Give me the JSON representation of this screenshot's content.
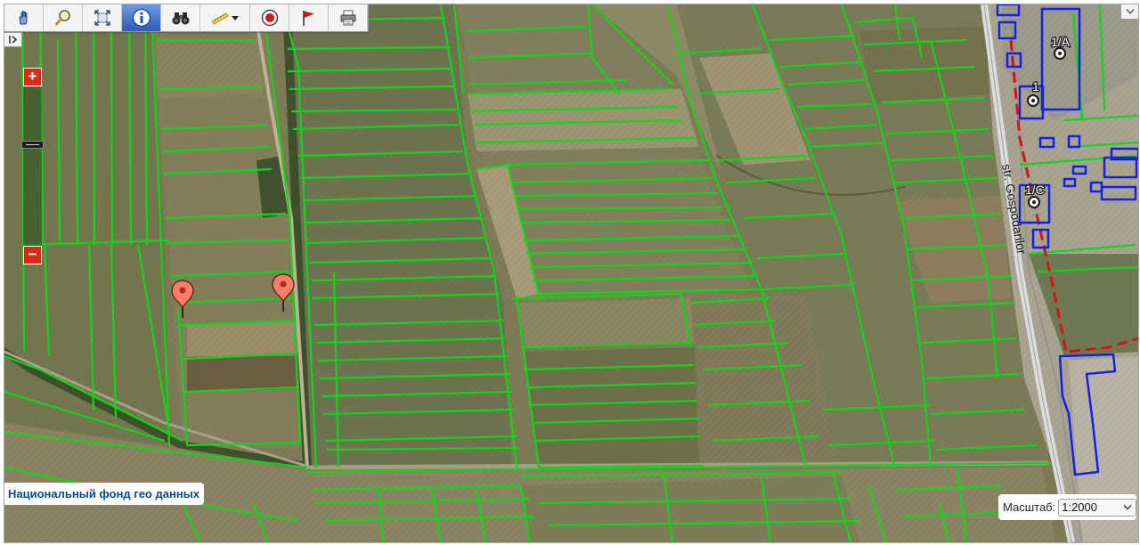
{
  "attribution": "Национальный фонд гео данных",
  "scale": {
    "label": "Масштаб:",
    "value": "1:2000"
  },
  "zoom": {
    "in": "+",
    "out": "−"
  },
  "street": "str. Gospodarilor",
  "addresses": [
    "1/A",
    "1",
    "1/C"
  ],
  "toolbar": {
    "tools": [
      {
        "name": "pan",
        "icon": "hand-icon"
      },
      {
        "name": "zoom-rectangle",
        "icon": "magnifier-icon"
      },
      {
        "name": "full-extent",
        "icon": "full-extent-icon"
      },
      {
        "name": "identify",
        "icon": "info-icon",
        "active": true
      },
      {
        "name": "search",
        "icon": "binoculars-icon"
      },
      {
        "name": "measure",
        "icon": "ruler-icon",
        "has_dropdown": true
      },
      {
        "name": "locate",
        "icon": "target-icon"
      },
      {
        "name": "mark",
        "icon": "flag-icon"
      },
      {
        "name": "print",
        "icon": "printer-icon"
      }
    ]
  },
  "markers": [
    {
      "name": "marker-1",
      "icon": "map-pin-icon",
      "color": "#ff7b6a"
    },
    {
      "name": "marker-2",
      "icon": "map-pin-icon",
      "color": "#ff7b6a"
    }
  ],
  "colors": {
    "parcel_lines": "#12d41a",
    "building_outlines": "#1420e8",
    "boundary_dashed": "#d4141a",
    "zoom_buttons": "#d62a1a",
    "attribution_text": "#0a4a8a",
    "active_tool": "#2e5db8"
  }
}
